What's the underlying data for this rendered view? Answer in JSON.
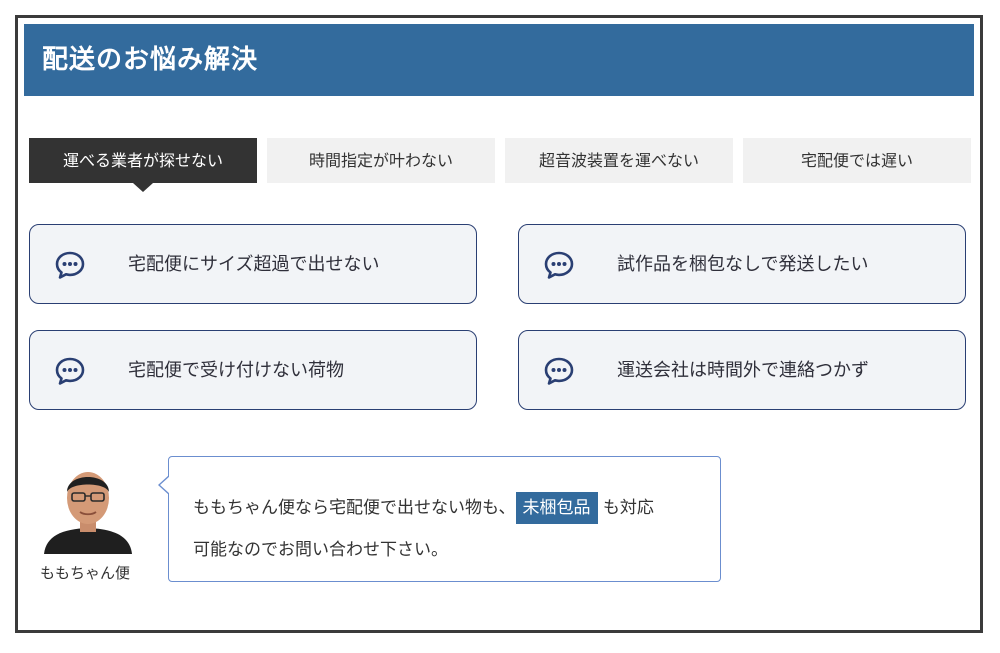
{
  "header": {
    "title": "配送のお悩み解決"
  },
  "tabs": [
    {
      "label": "運べる業者が探せない",
      "active": true
    },
    {
      "label": "時間指定が叶わない",
      "active": false
    },
    {
      "label": "超音波装置を運べない",
      "active": false
    },
    {
      "label": "宅配便では遅い",
      "active": false
    }
  ],
  "cards": [
    {
      "label": "宅配便にサイズ超過で出せない",
      "icon": "chat-bubble-icon"
    },
    {
      "label": "試作品を梱包なしで発送したい",
      "icon": "chat-bubble-icon"
    },
    {
      "label": "宅配便で受け付けない荷物",
      "icon": "chat-bubble-icon"
    },
    {
      "label": "運送会社は時間外で連絡つかず",
      "icon": "chat-bubble-icon"
    }
  ],
  "speaker": {
    "name": "ももちゃん便"
  },
  "bubble": {
    "text_before": "ももちゃん便なら宅配便で出せない物も、",
    "highlight": "未梱包品",
    "text_after": " も対応",
    "line2": "可能なのでお問い合わせ下さい。"
  },
  "colors": {
    "header": "#336b9d",
    "tab_active": "#333333",
    "card_border": "#2a3f73",
    "highlight": "#336b9d"
  }
}
